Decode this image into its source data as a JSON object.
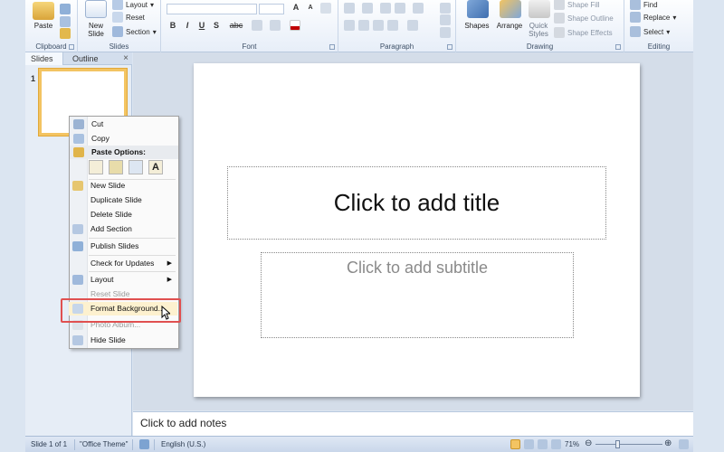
{
  "ribbon": {
    "clipboard": {
      "label": "Clipboard",
      "paste": "Paste"
    },
    "slides": {
      "label": "Slides",
      "new_slide": "New\nSlide",
      "layout": "Layout",
      "reset": "Reset",
      "section": "Section"
    },
    "font": {
      "label": "Font",
      "bold": "B",
      "italic": "I",
      "underline": "U",
      "strike": "S",
      "shadow": "abc",
      "grow": "A",
      "shrink": "A"
    },
    "paragraph": {
      "label": "Paragraph"
    },
    "drawing": {
      "label": "Drawing",
      "shapes": "Shapes",
      "arrange": "Arrange",
      "quick_styles": "Quick\nStyles",
      "shape_fill": "Shape Fill",
      "shape_outline": "Shape Outline",
      "shape_effects": "Shape Effects"
    },
    "editing": {
      "label": "Editing",
      "find": "Find",
      "replace": "Replace",
      "select": "Select"
    }
  },
  "left_pane": {
    "tabs": [
      "Slides",
      "Outline"
    ],
    "close": "×",
    "thumb_number": "1"
  },
  "slide": {
    "title_placeholder": "Click to add title",
    "subtitle_placeholder": "Click to add subtitle"
  },
  "notes_placeholder": "Click to add notes",
  "status": {
    "slide_info": "Slide 1 of 1",
    "theme": "\"Office Theme\"",
    "language": "English (U.S.)",
    "zoom": "71%"
  },
  "context_menu": {
    "cut": "Cut",
    "copy": "Copy",
    "paste_options": "Paste Options:",
    "paste_text_only": "A",
    "new_slide": "New Slide",
    "duplicate_slide": "Duplicate Slide",
    "delete_slide": "Delete Slide",
    "add_section": "Add Section",
    "publish_slides": "Publish Slides",
    "check_updates": "Check for Updates",
    "layout": "Layout",
    "reset_slide": "Reset Slide",
    "format_background": "Format Background...",
    "photo_album": "Photo Album...",
    "hide_slide": "Hide Slide"
  },
  "colors": {
    "accent_highlight": "#e05050",
    "thumb_border": "#f3c462",
    "ribbon_bg": "#e7eef8"
  }
}
